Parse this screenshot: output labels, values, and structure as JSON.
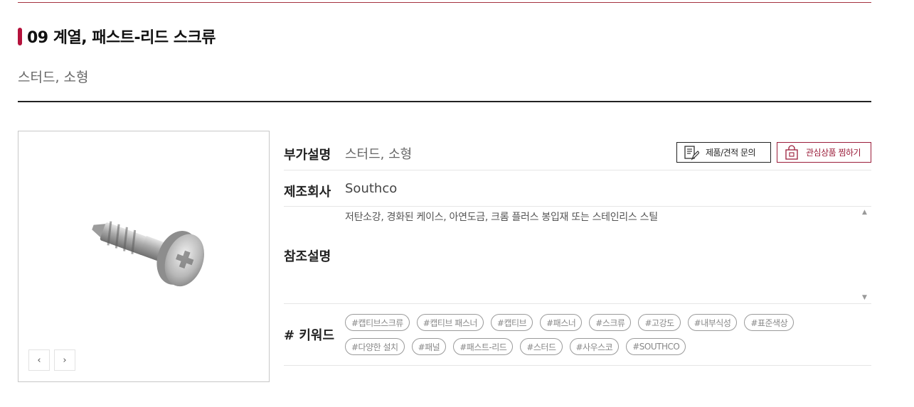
{
  "product": {
    "title": "09 계열, 패스트-리드 스크류",
    "subtitle": "스터드, 소형"
  },
  "gallery": {
    "image_icon": "screw-image",
    "prev_label": "‹",
    "next_label": "›"
  },
  "actions": {
    "inquiry_label": "제품/견적 문의",
    "inquiry_icon": "document-pen-icon",
    "wishlist_label": "관심상품 찜하기",
    "wishlist_icon": "shopping-bag-icon",
    "accent_color": "#9b1d3a"
  },
  "info": {
    "additional_label": "부가설명",
    "additional_value": "스터드, 소형",
    "maker_label": "제조회사",
    "maker_value": "Southco",
    "reference_label": "참조설명",
    "reference_value": "저탄소강, 경화된 케이스, 아연도금, 크롬 플러스 봉입재 또는 스테인리스 스틸",
    "keywords_label": "# 키워드"
  },
  "keywords": [
    "#캡티브스크류",
    "#캡티브 패스너",
    "#캡티브",
    "#패스너",
    "#스크류",
    "#고강도",
    "#내부식성",
    "#표준색상",
    "#다양한 설치",
    "#패널",
    "#패스트-리드",
    "#스터드",
    "#사우스코",
    "#SOUTHCO"
  ]
}
